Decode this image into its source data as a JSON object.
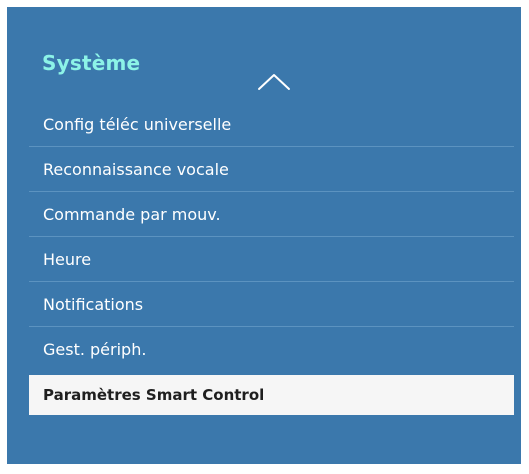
{
  "section": {
    "title": "Système",
    "collapse_icon": "chevron-up-icon"
  },
  "menu": {
    "items": [
      {
        "label": "Config téléc universelle"
      },
      {
        "label": "Reconnaissance vocale"
      },
      {
        "label": "Commande par mouv."
      },
      {
        "label": "Heure"
      },
      {
        "label": "Notifications"
      },
      {
        "label": "Gest. périph."
      },
      {
        "label": "Paramètres Smart Control"
      }
    ],
    "selected_index": 6
  },
  "colors": {
    "panel_background": "#3b78ac",
    "title_accent": "#8cf3e7",
    "item_text": "#ffffff",
    "selected_background": "#f6f6f6",
    "selected_text": "#1f1f1f"
  }
}
